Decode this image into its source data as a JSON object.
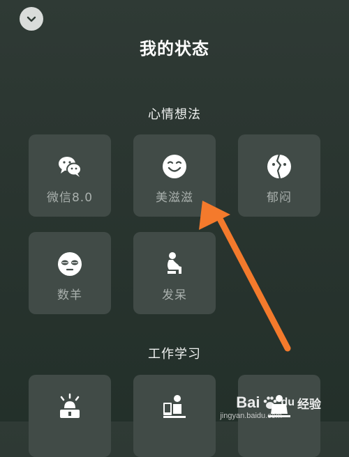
{
  "header": {
    "title": "我的状态",
    "collapse_icon": "chevron-down-icon"
  },
  "sections": [
    {
      "title": "心情想法",
      "tiles": [
        {
          "label": "微信8.0",
          "icon": "wechat-icon"
        },
        {
          "label": "美滋滋",
          "icon": "smile-icon"
        },
        {
          "label": "郁闷",
          "icon": "split-face-icon"
        },
        {
          "label": "数羊",
          "icon": "sleepy-face-icon"
        },
        {
          "label": "发呆",
          "icon": "sitting-figure-icon"
        }
      ]
    },
    {
      "title": "工作学习",
      "tiles": [
        {
          "label": "",
          "icon": "alarm-laptop-icon"
        },
        {
          "label": "",
          "icon": "studying-figure-icon"
        },
        {
          "label": "",
          "icon": "working-figure-icon"
        }
      ]
    }
  ],
  "watermark": {
    "brand": "Bai",
    "brand_suffix": "du",
    "jingyan": "经验",
    "url": "jingyan.baidu.com"
  },
  "colors": {
    "background": "#2a3530",
    "tile": "#414b47",
    "label": "#a9b0ad",
    "arrow": "#f47a2c"
  }
}
